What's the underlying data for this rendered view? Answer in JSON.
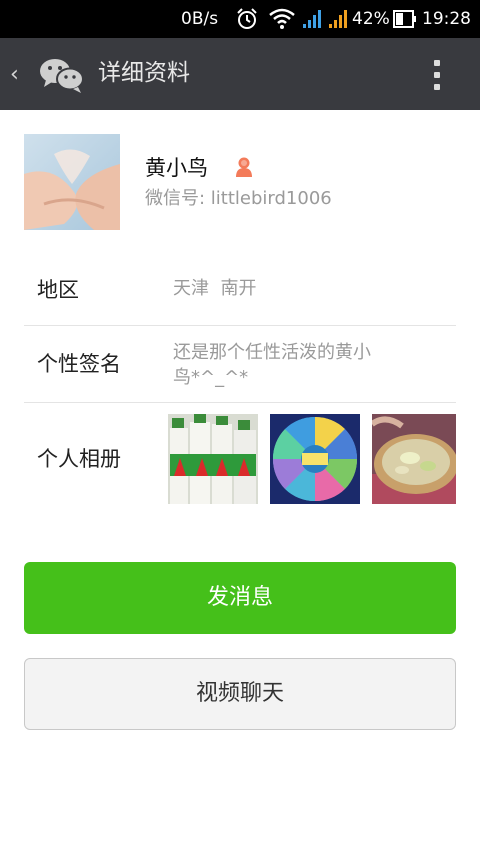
{
  "status_bar": {
    "network_speed": "0B/s",
    "battery_percent": "42%",
    "time": "19:28",
    "icons": [
      "alarm-icon",
      "wifi-icon",
      "signal-icon",
      "signal-icon",
      "battery-icon"
    ]
  },
  "header": {
    "title": "详细资料",
    "back_icon": "chevron-left-icon",
    "logo_icon": "wechat-logo-icon",
    "menu_icon": "more-vertical-icon"
  },
  "profile": {
    "name": "黄小鸟",
    "gender_icon": "female-icon",
    "wechat_id": "微信号: littlebird1006"
  },
  "details": {
    "region": {
      "label": "地区",
      "value": "天津  南开"
    },
    "signature": {
      "label": "个性签名",
      "value_line1": "还是那个任性活泼的黄小",
      "value_line2": "鸟*^_^*"
    },
    "album": {
      "label": "个人相册"
    }
  },
  "actions": {
    "send_message": "发消息",
    "video_chat": "视频聊天"
  },
  "colors": {
    "title_bar": "#393a3f",
    "primary_button": "#45c01a",
    "gender_icon": "#f37b5a",
    "secondary_text": "#9a9a9a"
  }
}
